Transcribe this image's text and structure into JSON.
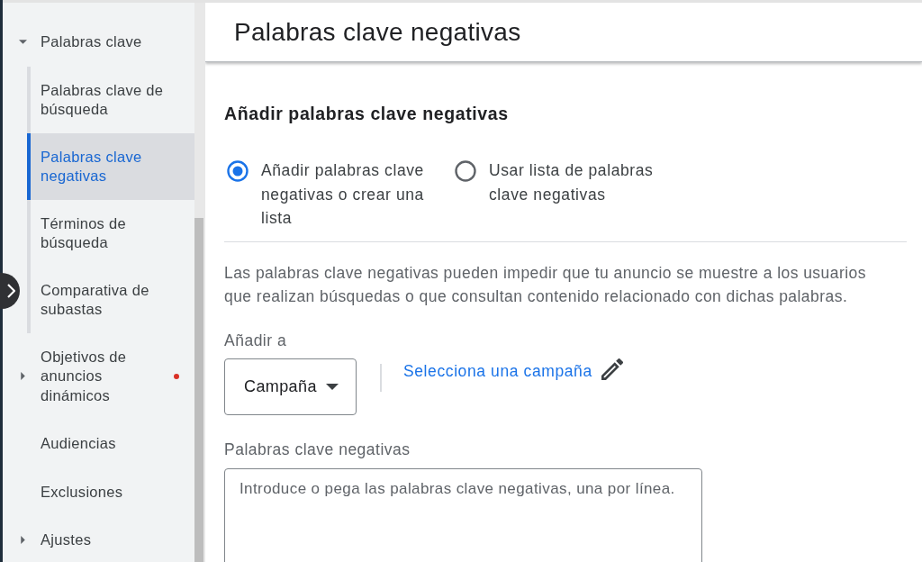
{
  "sidebar": {
    "items": [
      {
        "label": "Palabras clave",
        "expanded": true,
        "selected": false,
        "alert": false,
        "children": [
          {
            "label": "Palabras clave de búsqueda",
            "selected": false
          },
          {
            "label": "Palabras clave negativas",
            "selected": true
          },
          {
            "label": "Términos de búsqueda",
            "selected": false
          },
          {
            "label": "Comparativa de subastas",
            "selected": false
          }
        ]
      },
      {
        "label": "Objetivos de anuncios dinámicos",
        "expanded": false,
        "selected": false,
        "alert": true
      },
      {
        "label": "Audiencias",
        "selected": false,
        "alert": false
      },
      {
        "label": "Exclusiones",
        "selected": false,
        "alert": false
      },
      {
        "label": "Ajustes",
        "expanded": false,
        "selected": false,
        "alert": false
      }
    ]
  },
  "header": {
    "title": "Palabras clave negativas"
  },
  "form": {
    "heading": "Añadir palabras clave negativas",
    "options": [
      {
        "label": "Añadir palabras clave negativas o crear una lista",
        "selected": true
      },
      {
        "label": "Usar lista de palabras clave negativas",
        "selected": false
      }
    ],
    "description": "Las palabras clave negativas pueden impedir que tu anuncio se muestre a los usuarios que realizan búsquedas o que consultan contenido relacionado con dichas palabras.",
    "add_to": {
      "label": "Añadir a",
      "dropdown": {
        "value": "Campaña"
      },
      "link": "Selecciona una campaña"
    },
    "keywords": {
      "label": "Palabras clave negativas",
      "placeholder": "Introduce o pega las palabras clave negativas, una por línea."
    }
  }
}
